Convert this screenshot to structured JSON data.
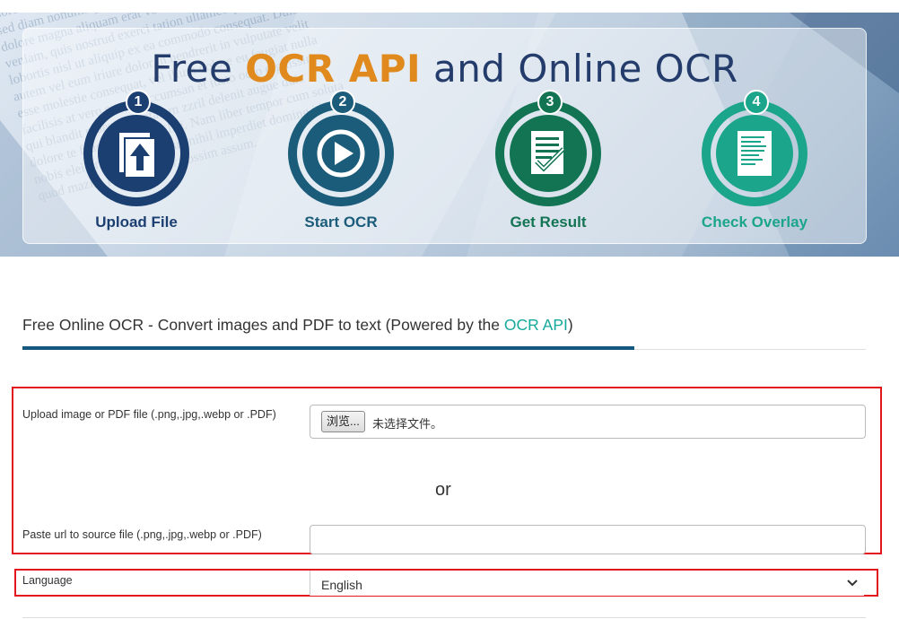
{
  "hero": {
    "title_prefix": "Free ",
    "title_accent": "OCR API",
    "title_suffix": " and Online OCR",
    "background_text": "Lorem ipsum dolor sit amet, consectetuer adipiscing elit, sed diam nonummy nibh euismod tincidunt ut laoreet dolore magna aliquam erat volutpat. Ut wisi enim ad minim veniam, quis nostrud exerci tation ullamcorper suscipit lobortis nisl ut aliquip ex ea commodo consequat. Duis autem vel eum iriure dolor in hendrerit in vulputate velit esse molestie consequat, vel illum dolore eu feugiat nulla facilisis at vero eros et accumsan et iusto odio dignissim qui blandit praesent luptatum zzril delenit augue duis dolore te feugait nulla facilisi. Nam liber tempor cum soluta nobis eleifend option congue nihil imperdiet doming id quod mazim placerat facer possim assum.",
    "steps": [
      {
        "number": "1",
        "label": "Upload File",
        "color": "#1c3f72",
        "icon": "upload-file-icon"
      },
      {
        "number": "2",
        "label": "Start OCR",
        "color": "#1b5c7a",
        "icon": "play-icon"
      },
      {
        "number": "3",
        "label": "Get Result",
        "color": "#137454",
        "icon": "document-check-icon"
      },
      {
        "number": "4",
        "label": "Check Overlay",
        "color": "#1ba58a",
        "icon": "text-overlay-icon"
      }
    ],
    "overlay_icon_text": "Lorem ipsum dolor sit amet, consectetuer adipiscing elit, sed diam nonummy nibh"
  },
  "section": {
    "title": "Free Online OCR - Convert images and PDF to text (Powered by the ",
    "link": "OCR API",
    "title_end": ")"
  },
  "form": {
    "upload_label": "Upload image or PDF file (.png,.jpg,.webp or .PDF)",
    "browse_button": "浏览...",
    "file_status": "未选择文件。",
    "or_text": "or",
    "url_label": "Paste url to source file (.png,.jpg,.webp or .PDF)",
    "url_value": "",
    "language_label": "Language",
    "language_value": "English"
  },
  "colors": {
    "accent_orange": "#e08a1e",
    "title_navy": "#243c6b",
    "link_teal": "#16a89b",
    "highlight_red": "#e3161d",
    "rule_blue": "#15587f"
  }
}
